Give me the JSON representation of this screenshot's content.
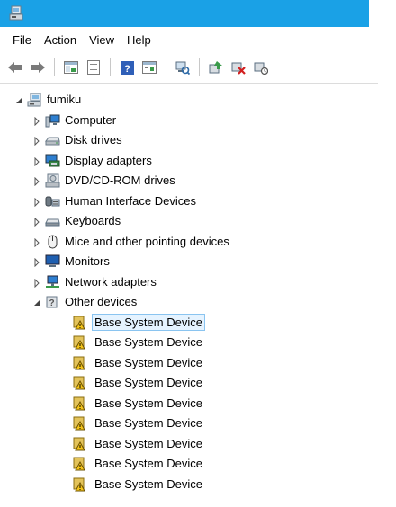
{
  "menu": {
    "file": "File",
    "action": "Action",
    "view": "View",
    "help": "Help"
  },
  "toolbar": {
    "icons": [
      "back-icon",
      "forward-icon",
      "show-hide-tree-icon",
      "properties-icon",
      "help-icon",
      "action-view-icon",
      "scan-hardware-icon",
      "update-driver-icon",
      "uninstall-device-icon",
      "disable-device-icon"
    ]
  },
  "tree": {
    "root": {
      "label": "fumiku"
    },
    "categories": [
      {
        "label": "Computer",
        "icon": "computer-icon"
      },
      {
        "label": "Disk drives",
        "icon": "disk-drive-icon"
      },
      {
        "label": "Display adapters",
        "icon": "display-adapter-icon"
      },
      {
        "label": "DVD/CD-ROM drives",
        "icon": "dvd-drive-icon"
      },
      {
        "label": "Human Interface Devices",
        "icon": "hid-icon"
      },
      {
        "label": "Keyboards",
        "icon": "keyboard-icon"
      },
      {
        "label": "Mice and other pointing devices",
        "icon": "mouse-icon"
      },
      {
        "label": "Monitors",
        "icon": "monitor-icon"
      },
      {
        "label": "Network adapters",
        "icon": "network-adapter-icon"
      },
      {
        "label": "Other devices",
        "icon": "other-devices-icon",
        "expanded": true
      }
    ],
    "other_devices": [
      "Base System Device",
      "Base System Device",
      "Base System Device",
      "Base System Device",
      "Base System Device",
      "Base System Device",
      "Base System Device",
      "Base System Device",
      "Base System Device"
    ]
  },
  "colors": {
    "titlebar": "#1aa1e6",
    "selection_bg": "#e5f3ff",
    "selection_border": "#8ac4f0"
  }
}
